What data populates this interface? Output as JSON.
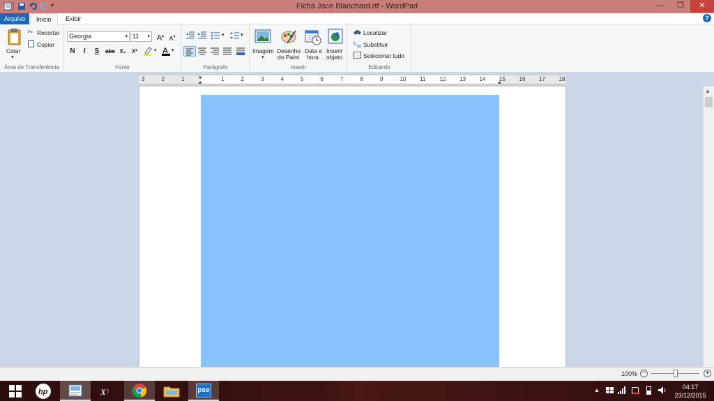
{
  "window": {
    "title": "Ficha Jace Blanchard.rtf - WordPad",
    "controls": {
      "minimize": "—",
      "restore": "❐",
      "close": "✕"
    }
  },
  "tabs": {
    "file": "Arquivo",
    "home": "Início",
    "view": "Exibir"
  },
  "clipboard": {
    "paste": "Colar",
    "cut": "Recortar",
    "copy": "Copiar",
    "group": "Área de Transferência"
  },
  "font": {
    "family": "Georgia",
    "size": "11",
    "grow": "A",
    "shrink": "A",
    "bold": "N",
    "italic": "I",
    "underline": "S",
    "strike": "abc",
    "subscript": "X₂",
    "superscript": "X²",
    "group": "Fonte"
  },
  "paragraph": {
    "group": "Parágrafo"
  },
  "insert": {
    "image_line1": "Imagem",
    "paint_line1": "Desenho",
    "paint_line2": "do Paint",
    "date_line1": "Data e",
    "date_line2": "hora",
    "object_line1": "Inserir",
    "object_line2": "objeto",
    "group": "Inserir"
  },
  "editing": {
    "find": "Localizar",
    "replace": "Substituir",
    "select_all": "Selecionar tudo",
    "group": "Editando"
  },
  "ruler": {
    "labels": [
      "3",
      "2",
      "1",
      "1",
      "2",
      "3",
      "4",
      "5",
      "6",
      "7",
      "8",
      "9",
      "10",
      "11",
      "12",
      "13",
      "14",
      "15",
      "16",
      "17",
      "18"
    ]
  },
  "status": {
    "zoom": "100%"
  },
  "taskbar": {
    "time": "04:17",
    "date": "23/12/2015",
    "pse_label": "pse"
  },
  "colors": {
    "titlebar": "#c87f7a",
    "file_tab": "#1e69b5",
    "image_fill": "#8ac2ff",
    "canvas": "#cbd7e8"
  }
}
